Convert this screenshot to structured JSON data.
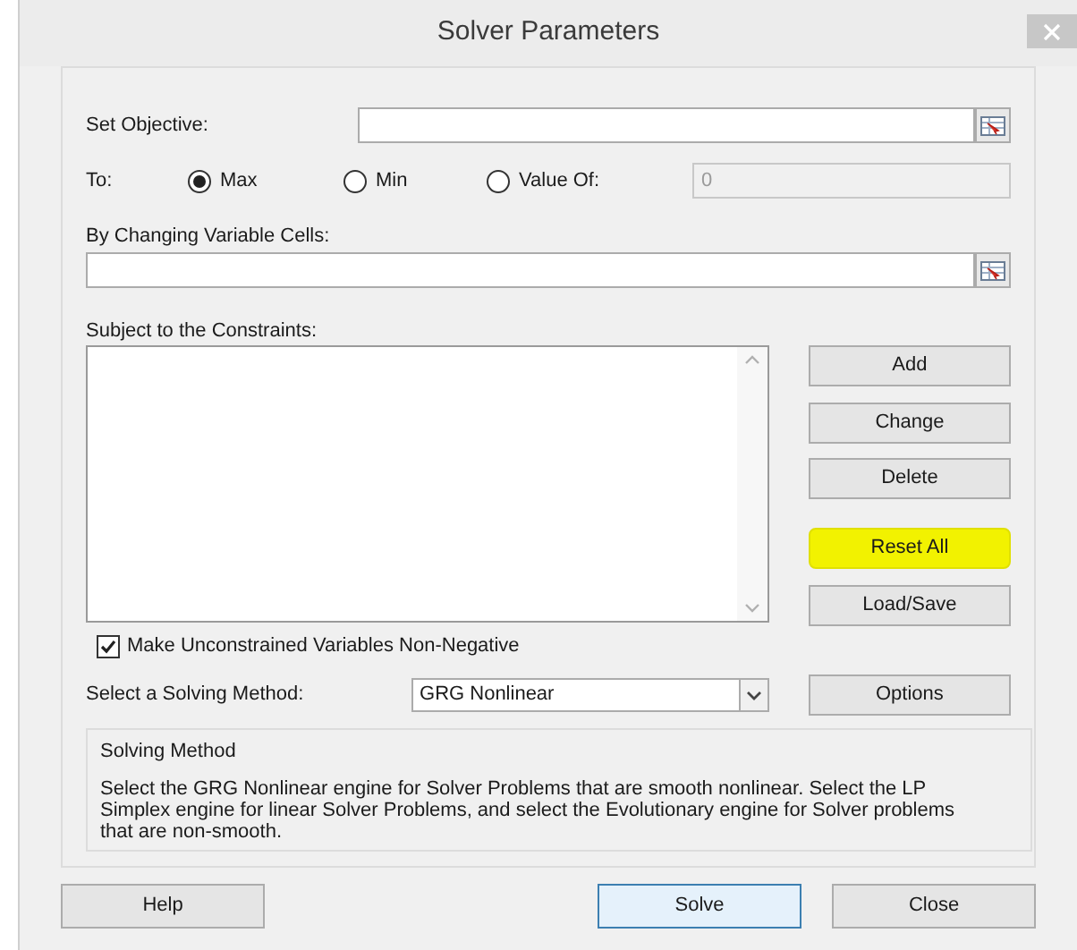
{
  "window": {
    "title": "Solver Parameters"
  },
  "objective": {
    "label": "Set Objective:"
  },
  "to": {
    "label": "To:",
    "options": [
      {
        "label": "Max",
        "selected": true
      },
      {
        "label": "Min",
        "selected": false
      },
      {
        "label": "Value Of:",
        "selected": false
      }
    ],
    "value_field": {
      "value": "0",
      "disabled": true
    }
  },
  "changing_cells": {
    "label": "By Changing Variable Cells:"
  },
  "constraints": {
    "label": "Subject to the Constraints:"
  },
  "side_buttons": [
    {
      "label": "Add",
      "highlighted": false
    },
    {
      "label": "Change",
      "highlighted": false
    },
    {
      "label": "Delete",
      "highlighted": false
    },
    {
      "label": "Reset All",
      "highlighted": true
    },
    {
      "label": "Load/Save",
      "highlighted": false
    }
  ],
  "non_negative": {
    "label": "Make Unconstrained Variables Non-Negative",
    "checked": true
  },
  "solving_method": {
    "label": "Select a Solving Method:",
    "value": "GRG Nonlinear",
    "options_button": "Options"
  },
  "method_info": {
    "title": "Solving Method",
    "text": "Select the GRG Nonlinear engine for Solver Problems that are smooth nonlinear. Select the LP Simplex engine for linear Solver Problems, and select the Evolutionary engine for Solver problems that are non-smooth."
  },
  "footer_buttons": [
    {
      "label": "Help",
      "default": false
    },
    {
      "label": "Solve",
      "default": true
    },
    {
      "label": "Close",
      "default": false
    }
  ]
}
